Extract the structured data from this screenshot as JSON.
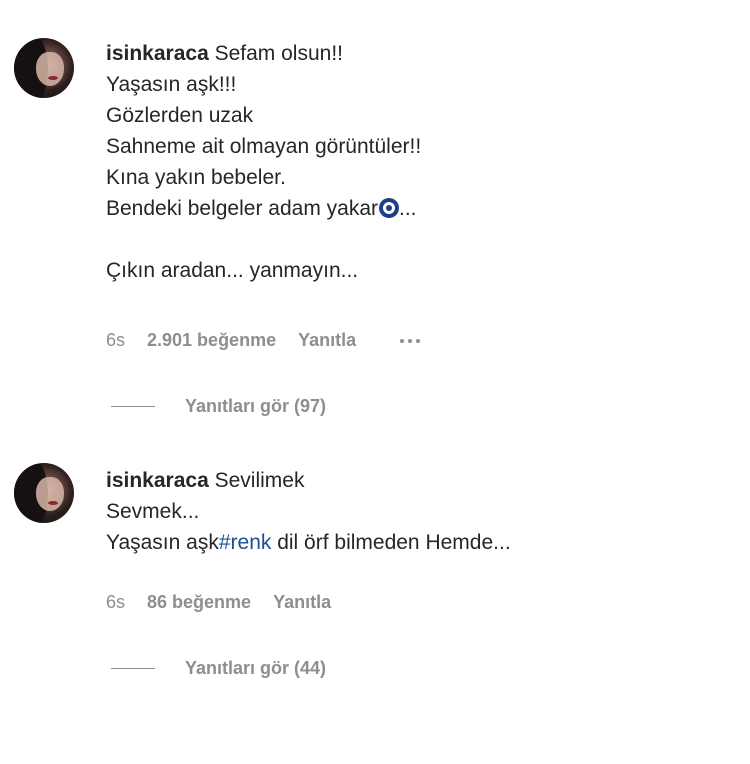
{
  "comments": [
    {
      "username": "isinkaraca",
      "lines": [
        "Sefam olsun!!",
        "Yaşasın aşk!!!",
        "Gözlerden uzak",
        "Sahneme ait olmayan görüntüler!!",
        "Kına yakın bebeler.",
        "Bendeki belgeler adam yakar",
        "...",
        "Çıkın aradan... yanmayın..."
      ],
      "time": "6s",
      "likes": "2.901 beğenme",
      "reply_label": "Yanıtla",
      "more_icon": "more-horizontal-icon",
      "view_replies": "Yanıtları gör (97)"
    },
    {
      "username": "isinkaraca",
      "lines": [
        "Sevilimek",
        "Sevmek...",
        "Yaşasın aşk",
        "#renk",
        " dil örf bilmeden Hemde..."
      ],
      "time": "6s",
      "likes": "86 beğenme",
      "reply_label": "Yanıtla",
      "view_replies": "Yanıtları gör (44)"
    }
  ],
  "colors": {
    "hashtag": "#1f4f93",
    "meta": "#8e8e8e",
    "evil_eye": "#1d3f8a"
  }
}
